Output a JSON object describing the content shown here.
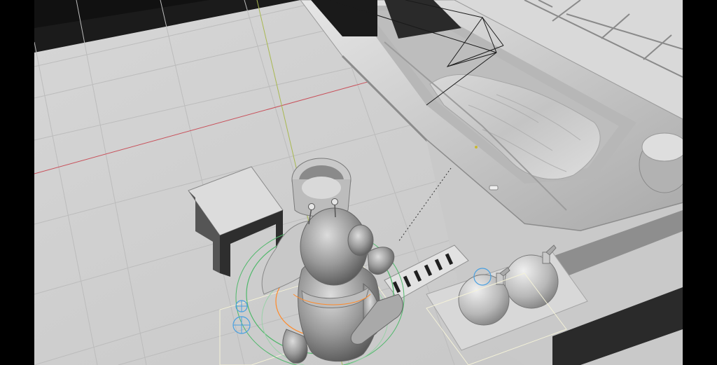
{
  "viewport": {
    "background": "#cfcfcf",
    "floor_color": "#d2d2d2",
    "grid_color": "#bdbdbd",
    "x_axis_color": "#c8505a",
    "y_axis_color": "#a8b850",
    "selection_color": "#ff8a2a",
    "rig_green": "#4fb86a",
    "rig_blue": "#4aa0e0",
    "light_frame": "#f4f2d8",
    "camera_color": "#1a1a1a"
  },
  "objects": [
    {
      "name": "character-figure",
      "label": "",
      "selected": true
    },
    {
      "name": "bucket-object",
      "label": ""
    },
    {
      "name": "stool-object",
      "label": ""
    },
    {
      "name": "bathtub-object",
      "label": ""
    },
    {
      "name": "camera-object",
      "label": ""
    },
    {
      "name": "bottle-object-1",
      "label": ""
    },
    {
      "name": "bottle-object-2",
      "label": ""
    },
    {
      "name": "drain-grate-object",
      "label": ""
    }
  ]
}
